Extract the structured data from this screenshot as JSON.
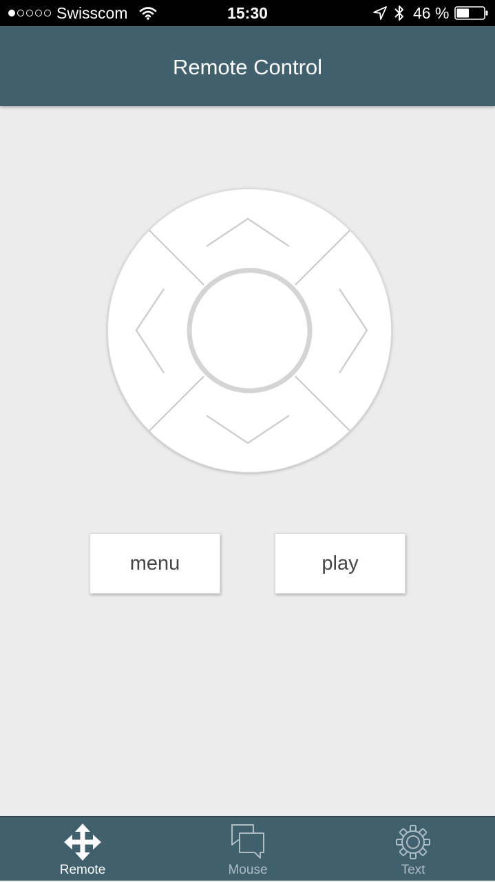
{
  "status_bar": {
    "carrier": "Swisscom",
    "signal_bars_filled": 1,
    "signal_bars_total": 5,
    "time": "15:30",
    "battery_percent_text": "46 %",
    "battery_level": 0.46
  },
  "nav": {
    "title": "Remote Control"
  },
  "controls": {
    "menu_label": "menu",
    "play_label": "play"
  },
  "tabs": [
    {
      "label": "Remote",
      "icon": "move-arrows-icon",
      "active": true
    },
    {
      "label": "Mouse",
      "icon": "chat-bubbles-icon",
      "active": false
    },
    {
      "label": "Text",
      "icon": "gear-icon",
      "active": false
    }
  ],
  "colors": {
    "nav_background": "#41606e",
    "page_background": "#ececec",
    "active_tab": "#ffffff",
    "inactive_tab": "#aebcc4"
  }
}
